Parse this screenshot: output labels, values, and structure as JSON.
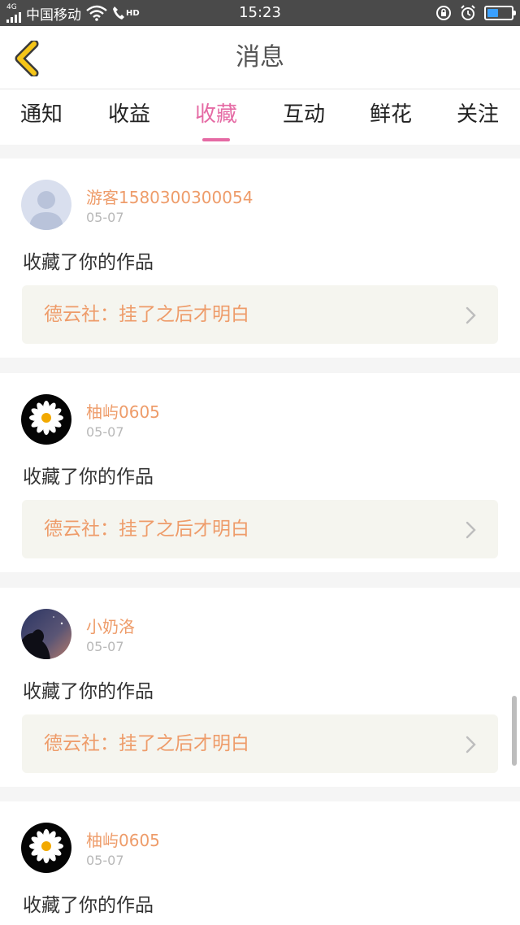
{
  "status_bar": {
    "network": "4G",
    "carrier": "中国移动",
    "call_badge": "HD",
    "time": "15:23",
    "battery_percent": 45
  },
  "header": {
    "title": "消息",
    "back_icon": "chevron-left-icon",
    "back_color": "#f5c518"
  },
  "tabs": [
    {
      "label": "通知",
      "active": false
    },
    {
      "label": "收益",
      "active": false
    },
    {
      "label": "收藏",
      "active": true
    },
    {
      "label": "互动",
      "active": false
    },
    {
      "label": "鲜花",
      "active": false
    },
    {
      "label": "关注",
      "active": false
    }
  ],
  "colors": {
    "accent": "#e56aa4",
    "username": "#ee9c6a",
    "link_bg": "#f5f5ef"
  },
  "messages": [
    {
      "username": "游客1580300300054",
      "date": "05-07",
      "action": "收藏了你的作品",
      "work_title": "德云社：挂了之后才明白",
      "avatar": "default-avatar"
    },
    {
      "username": "柚屿0605",
      "date": "05-07",
      "action": "收藏了你的作品",
      "work_title": "德云社：挂了之后才明白",
      "avatar": "daisy-avatar"
    },
    {
      "username": "小奶洛",
      "date": "05-07",
      "action": "收藏了你的作品",
      "work_title": "德云社：挂了之后才明白",
      "avatar": "night-avatar"
    },
    {
      "username": "柚屿0605",
      "date": "05-07",
      "action": "收藏了你的作品",
      "avatar": "daisy-avatar"
    }
  ]
}
